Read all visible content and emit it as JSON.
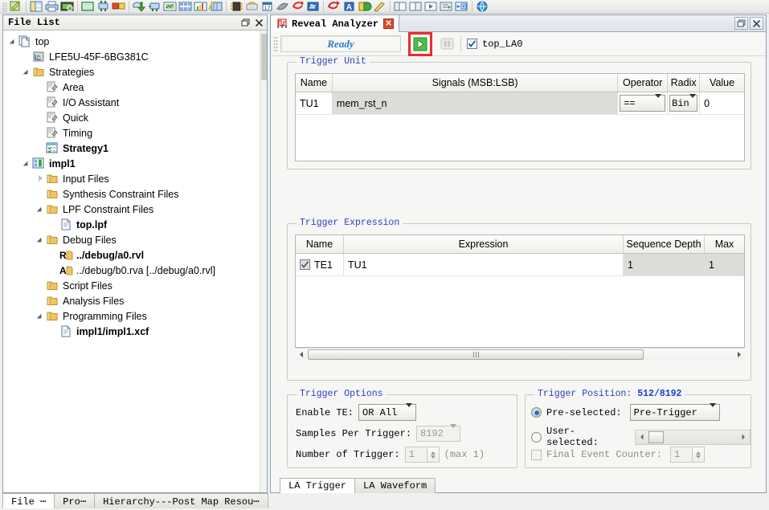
{
  "toolbar": {
    "icons": [
      "edit-pencil-icon",
      "window-split-icon",
      "printer-icon",
      "print-preview-icon",
      "resize-window-icon",
      "assign-pins-icon",
      "package-view-icon",
      "export-down-icon",
      "netlist-analyzer-icon",
      "floorplan-icon",
      "spreadsheet-icon",
      "bar-chart-icon",
      "timing-analysis-icon",
      "device-chip-icon",
      "programmer-icon",
      "calendar-icon",
      "power-calculator-icon",
      "reveal-inserter-icon",
      "reveal-analyzer-icon",
      "debug-dd-icon",
      "simulation-wizard-icon",
      "tile-horizontal-icon",
      "tile-vertical-icon",
      "play-waveform-icon",
      "script-editor-icon",
      "add-window-icon",
      "web-browser-icon"
    ]
  },
  "left_panel": {
    "title": "File List",
    "restore_icon": "restore-window-icon",
    "close_icon": "close-icon",
    "tree": [
      {
        "label": "top",
        "indent": 0,
        "twisty": "open",
        "icon": "document-pair-icon",
        "bold": false
      },
      {
        "label": "LFE5U-45F-6BG381C",
        "indent": 1,
        "twisty": "none",
        "icon": "device-icon",
        "bold": false
      },
      {
        "label": "Strategies",
        "indent": 1,
        "twisty": "open",
        "icon": "folder-icon",
        "bold": false
      },
      {
        "label": "Area",
        "indent": 2,
        "twisty": "none",
        "icon": "strategy-icon",
        "bold": false
      },
      {
        "label": "I/O Assistant",
        "indent": 2,
        "twisty": "none",
        "icon": "strategy-icon",
        "bold": false
      },
      {
        "label": "Quick",
        "indent": 2,
        "twisty": "none",
        "icon": "strategy-icon",
        "bold": false
      },
      {
        "label": "Timing",
        "indent": 2,
        "twisty": "none",
        "icon": "strategy-icon",
        "bold": false
      },
      {
        "label": "Strategy1",
        "indent": 2,
        "twisty": "none",
        "icon": "strategy-active-icon",
        "bold": true
      },
      {
        "label": "impl1",
        "indent": 1,
        "twisty": "open",
        "icon": "implementation-icon",
        "bold": true
      },
      {
        "label": "Input Files",
        "indent": 2,
        "twisty": "closed",
        "icon": "folder-icon",
        "bold": false
      },
      {
        "label": "Synthesis Constraint Files",
        "indent": 2,
        "twisty": "none",
        "icon": "folder-icon",
        "bold": false
      },
      {
        "label": "LPF Constraint Files",
        "indent": 2,
        "twisty": "open",
        "icon": "folder-icon",
        "bold": false
      },
      {
        "label": "top.lpf",
        "indent": 3,
        "twisty": "none",
        "icon": "file-icon",
        "bold": true
      },
      {
        "label": "Debug Files",
        "indent": 2,
        "twisty": "open",
        "icon": "folder-icon",
        "bold": false
      },
      {
        "label": "../debug/a0.rvl",
        "indent": 3,
        "twisty": "none",
        "icon": "rvl-file-icon",
        "bold": true
      },
      {
        "label": "../debug/b0.rva [../debug/a0.rvl]",
        "indent": 3,
        "twisty": "none",
        "icon": "rva-file-icon",
        "bold": false
      },
      {
        "label": "Script Files",
        "indent": 2,
        "twisty": "none",
        "icon": "folder-icon",
        "bold": false
      },
      {
        "label": "Analysis Files",
        "indent": 2,
        "twisty": "none",
        "icon": "folder-icon",
        "bold": false
      },
      {
        "label": "Programming Files",
        "indent": 2,
        "twisty": "open",
        "icon": "folder-icon",
        "bold": false
      },
      {
        "label": "impl1/impl1.xcf",
        "indent": 3,
        "twisty": "none",
        "icon": "file-icon",
        "bold": true
      }
    ],
    "bottom_tabs": [
      {
        "label": "File ⋯",
        "active": true
      },
      {
        "label": "Pro⋯",
        "active": false
      },
      {
        "label": "Hierarchy---Post Map Resou⋯",
        "active": false
      }
    ]
  },
  "reveal_analyzer": {
    "tab_title": "Reveal Analyzer",
    "tab_icon": "reveal-analyzer-icon",
    "tab_close_label": "✕",
    "window_restore": "❐",
    "window_close": "✕",
    "toolbar": {
      "status": "Ready",
      "run_icon": "run-play-icon",
      "stop_icon": "stop-icon",
      "la_checkbox_checked": true,
      "la_name": "top_LA0",
      "highlight_color": "#ef2a2a"
    },
    "trigger_unit": {
      "title": "Trigger Unit",
      "headers": [
        "Name",
        "Signals (MSB:LSB)",
        "Operator",
        "Radix",
        "Value"
      ],
      "rows": [
        {
          "name": "TU1",
          "signals": "mem_rst_n",
          "operator": "==",
          "radix": "Bin",
          "value": "0"
        }
      ]
    },
    "trigger_expression": {
      "title": "Trigger Expression",
      "headers": [
        "Name",
        "Expression",
        "Sequence Depth",
        "Max"
      ],
      "rows": [
        {
          "checked": true,
          "name": "TE1",
          "expression": "TU1",
          "sequence_depth": "1",
          "max": "1"
        }
      ]
    },
    "trigger_options": {
      "title": "Trigger Options",
      "enable_te_label": "Enable TE:",
      "enable_te_value": "OR All",
      "samples_label": "Samples Per Trigger:",
      "samples_value": "8192",
      "number_label": "Number of Trigger:",
      "number_value": "1",
      "number_max_note": "(max 1)"
    },
    "trigger_position": {
      "title_label": "Trigger Position:",
      "title_value": "512/8192",
      "preselected_label": "Pre-selected:",
      "preselected_value": "Pre-Trigger",
      "preselected_checked": true,
      "userselected_label": "User-selected:",
      "userselected_checked": false,
      "final_event_label": "Final Event Counter:",
      "final_event_checked": false,
      "final_event_value": "1"
    },
    "bottom_tabs": [
      {
        "label": "LA Trigger",
        "active": true
      },
      {
        "label": "LA Waveform",
        "active": false
      }
    ]
  }
}
